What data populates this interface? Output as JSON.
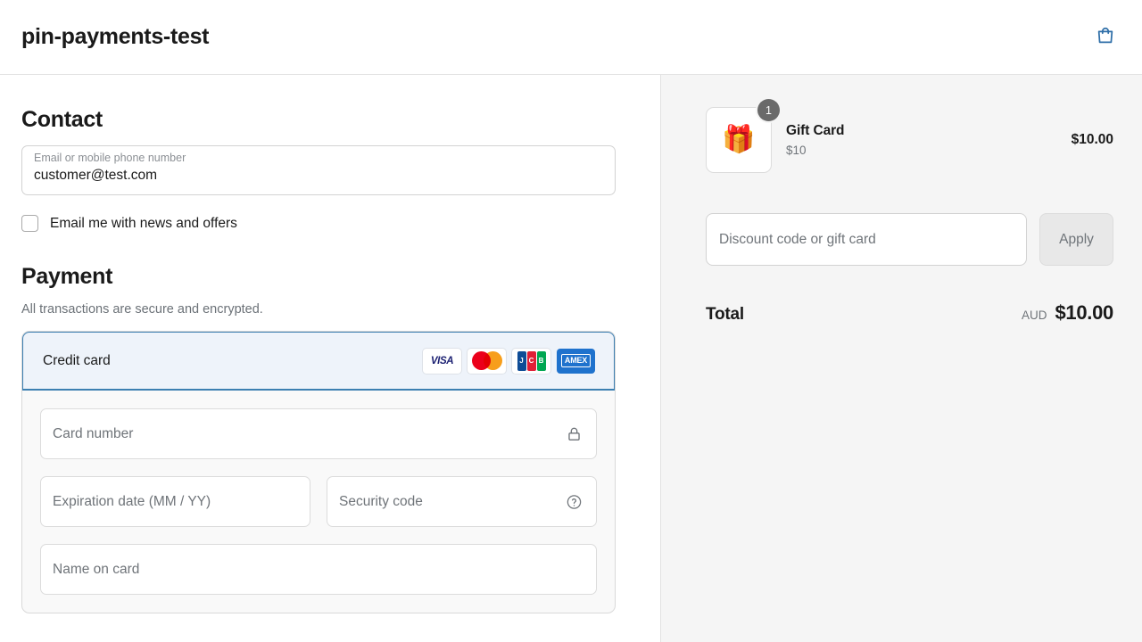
{
  "header": {
    "shop_title": "pin-payments-test",
    "cart_icon": "shopping-bag-icon",
    "cart_icon_color": "#2f6fa8"
  },
  "contact": {
    "heading": "Contact",
    "email_field": {
      "label": "Email or mobile phone number",
      "value": "customer@test.com"
    },
    "newsletter": {
      "label": "Email me with news and offers",
      "checked": false
    }
  },
  "payment": {
    "heading": "Payment",
    "subtitle": "All transactions are secure and encrypted.",
    "method": {
      "label": "Credit card",
      "selected": true,
      "selected_border_color": "#3c7fb1",
      "selected_bg_color": "#eef3fa",
      "brands": [
        {
          "name": "visa-logo",
          "text": "VISA"
        },
        {
          "name": "mastercard-logo",
          "text": ""
        },
        {
          "name": "jcb-logo",
          "letters": [
            "J",
            "C",
            "B"
          ]
        },
        {
          "name": "amex-logo",
          "text": "AMEX"
        }
      ]
    },
    "fields": {
      "card_number": {
        "placeholder": "Card number",
        "icon": "lock-icon"
      },
      "expiration": {
        "placeholder": "Expiration date (MM / YY)"
      },
      "security_code": {
        "placeholder": "Security code",
        "icon": "question-circle-icon"
      },
      "name_on_card": {
        "placeholder": "Name on card"
      }
    }
  },
  "order_summary": {
    "item": {
      "thumbnail_icon": "gift-icon",
      "quantity_badge": "1",
      "title": "Gift Card",
      "variant": "$10",
      "price": "$10.00"
    },
    "discount": {
      "placeholder": "Discount code or gift card",
      "value": "",
      "apply_label": "Apply"
    },
    "total": {
      "label": "Total",
      "currency": "AUD",
      "amount": "$10.00"
    }
  }
}
